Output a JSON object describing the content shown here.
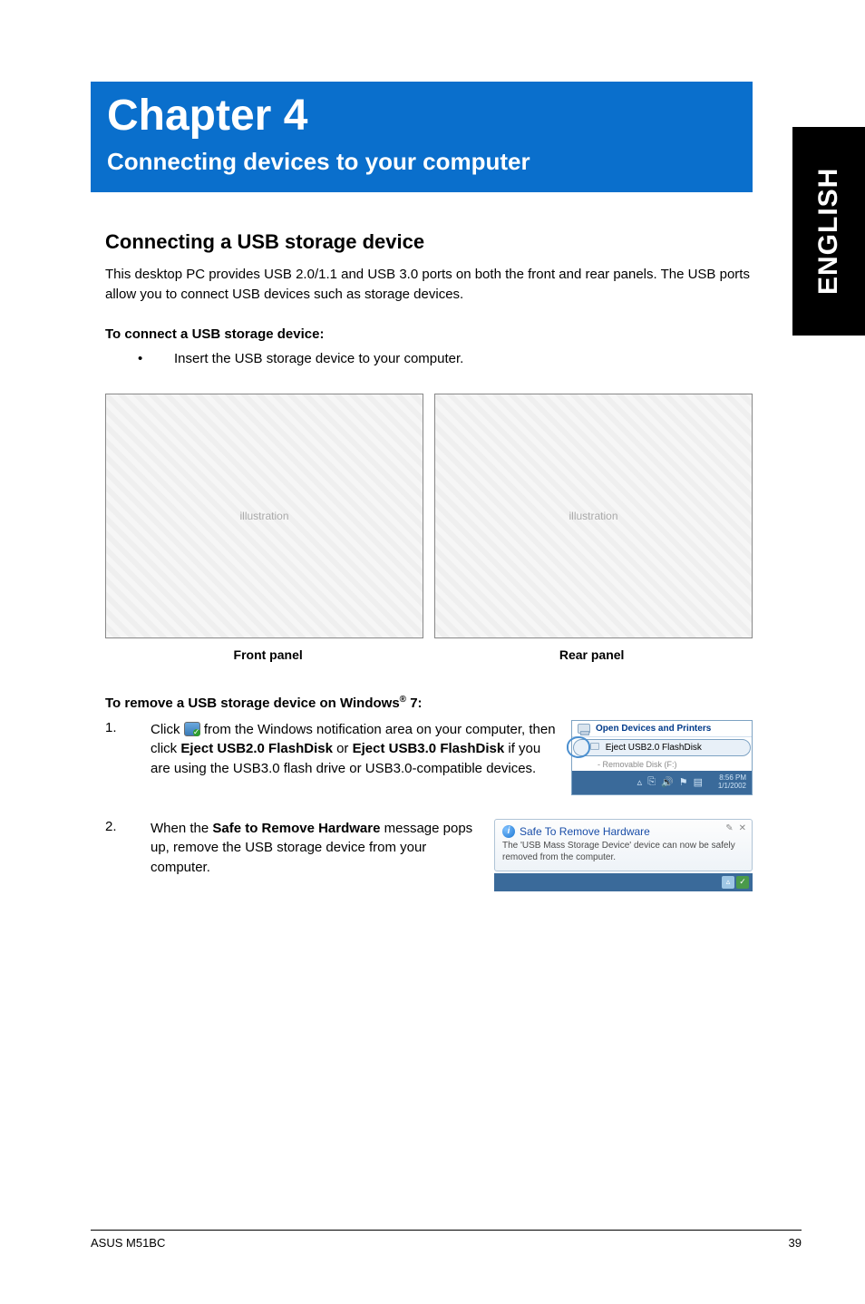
{
  "side_tab": "ENGLISH",
  "chapter": {
    "title": "Chapter 4",
    "subtitle": "Connecting devices to your computer"
  },
  "section": {
    "heading": "Connecting a USB storage device",
    "intro": "This desktop PC provides USB 2.0/1.1 and USB 3.0 ports on both the front and rear panels. The USB ports allow you to connect USB devices such as storage devices.",
    "connect_heading": "To connect a USB storage device:",
    "connect_bullet": "Insert the USB storage device to your computer.",
    "front_label": "Front panel",
    "rear_label": "Rear panel",
    "remove_heading_pre": "To remove a USB storage device on Windows",
    "remove_heading_post": " 7:",
    "step1": {
      "num": "1.",
      "pre": "Click ",
      "post_icon": " from the Windows notification area on your computer, then click ",
      "bold1": "Eject USB2.0 FlashDisk",
      "or": " or ",
      "bold2": "Eject USB3.0 FlashDisk",
      "post": " if you are using the USB3.0 flash drive or USB3.0-compatible devices."
    },
    "step2": {
      "num": "2.",
      "pre": "When the ",
      "bold": "Safe to Remove Hardware",
      "post": " message pops up, remove the USB storage device from your computer."
    }
  },
  "popup1": {
    "open": "Open Devices and Printers",
    "eject": "Eject USB2.0 FlashDisk",
    "removable": "-   Removable Disk (F:)",
    "time": "8:56 PM",
    "date": "1/1/2002"
  },
  "balloon": {
    "title": "Safe To Remove Hardware",
    "msg": "The 'USB Mass Storage Device' device can now be safely removed from the computer."
  },
  "footer": {
    "left": "ASUS M51BC",
    "right": "39"
  }
}
